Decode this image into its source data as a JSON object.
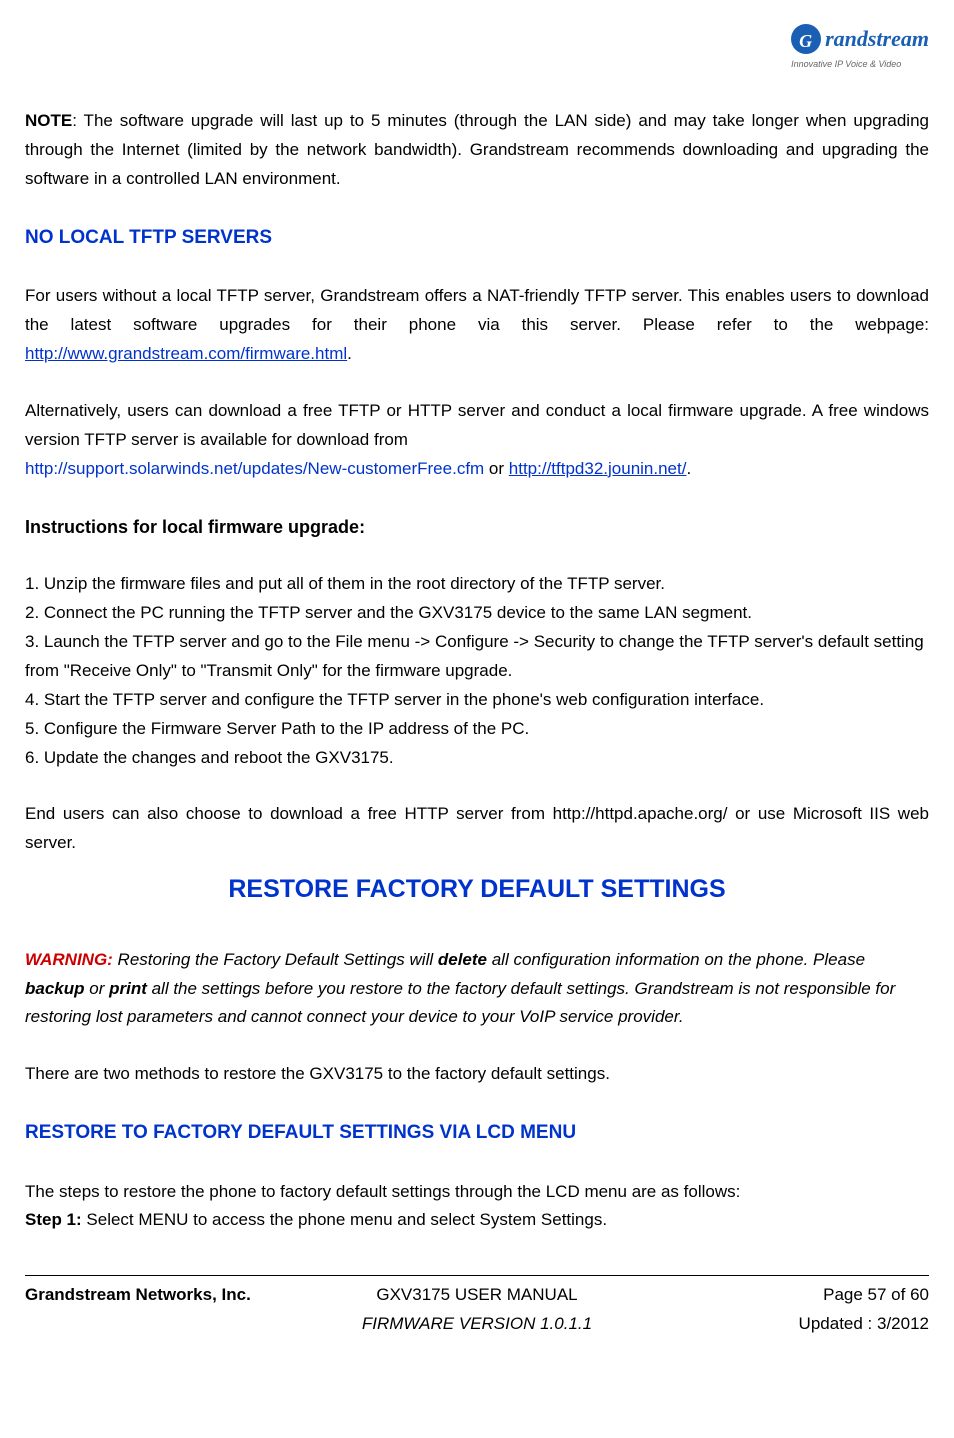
{
  "logo": {
    "brand": "randstream",
    "tagline": "Innovative IP Voice & Video"
  },
  "noteSection": {
    "label": "NOTE",
    "text": ": The software upgrade will last up to 5 minutes (through the LAN side) and may take longer when upgrading through the Internet (limited by the network bandwidth). Grandstream recommends downloading and upgrading the software in a controlled LAN environment."
  },
  "heading1": "NO LOCAL TFTP SERVERS",
  "para1": {
    "prefix": "For users without a local TFTP server, Grandstream offers a NAT-friendly TFTP server. This enables users to download the latest software upgrades for their phone via this server. Please refer to the webpage: ",
    "link": "http://www.grandstream.com/firmware.html",
    "suffix": "."
  },
  "para2": {
    "line1": "Alternatively, users can download a free TFTP or HTTP server and conduct a local firmware upgrade. A free windows version TFTP server is available for download from",
    "link1": "http://support.solarwinds.net/updates/New-customerFree.cfm",
    "middle": " or ",
    "link2": "http://tftpd32.jounin.net/",
    "suffix": "."
  },
  "subheading1": "Instructions for local firmware upgrade",
  "steps": [
    "1. Unzip the firmware files and put all of them in the root directory of the TFTP server.",
    "2. Connect the PC running the TFTP server and the GXV3175 device to the same LAN segment.",
    "3. Launch the TFTP server and go to the File menu -> Configure -> Security to change the TFTP server's default setting from \"Receive Only\" to \"Transmit Only\" for the firmware upgrade.",
    "4. Start the TFTP server and configure the TFTP server in the phone's web configuration interface.",
    "5. Configure the Firmware Server Path to the IP address of the PC.",
    "6. Update the changes and reboot the GXV3175."
  ],
  "para3": "End users can also choose to download a free HTTP server from http://httpd.apache.org/ or use Microsoft IIS web server.",
  "mainTitle": "RESTORE FACTORY DEFAULT SETTINGS",
  "warning": {
    "label": "WARNING:",
    "text1": " Restoring the Factory Default Settings will ",
    "bold1": "delete",
    "text2": " all configuration information on the phone. Please ",
    "bold2": "backup",
    "text3": " or ",
    "bold3": "print",
    "text4": " all the settings before you restore to the factory default settings. Grandstream is not responsible for restoring lost parameters and cannot connect your device to your VoIP service provider."
  },
  "para4": "There are two methods to restore the GXV3175 to the factory default settings.",
  "heading2": "RESTORE TO FACTORY DEFAULT SETTINGS VIA LCD MENU",
  "para5": "The steps to restore the phone to factory default settings through the LCD menu are as follows:",
  "step1": {
    "label": "Step 1:",
    "text": " Select MENU to access the phone menu and select System Settings."
  },
  "footer": {
    "left": "Grandstream Networks, Inc.",
    "centerLine1": "GXV3175 USER MANUAL",
    "centerLine2": "FIRMWARE VERSION 1.0.1.1",
    "rightLine1": "Page 57 of 60",
    "rightLine2": "Updated : 3/2012"
  }
}
